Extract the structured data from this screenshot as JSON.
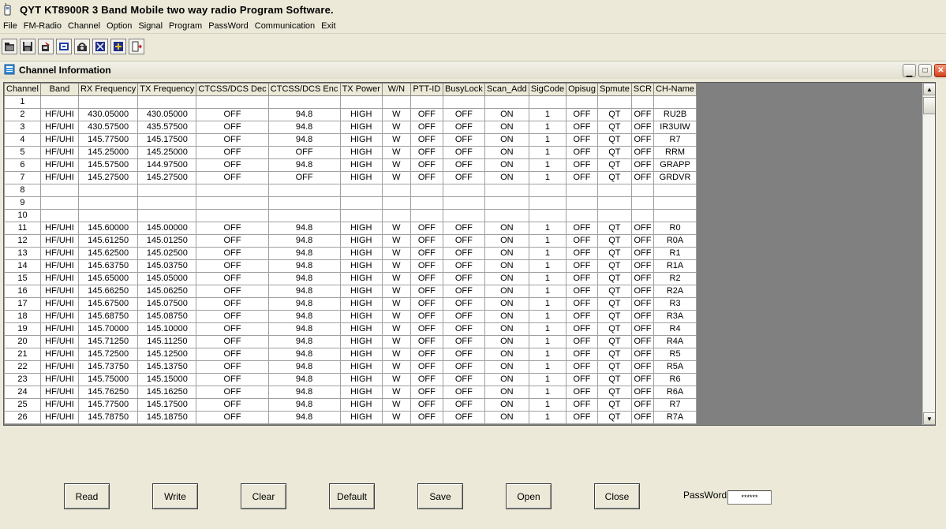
{
  "app": {
    "title": "QYT KT8900R 3 Band Mobile two way radio Program Software."
  },
  "menu": [
    "File",
    "FM-Radio",
    "Channel",
    "Option",
    "Signal",
    "Program",
    "PassWord",
    "Communication",
    "Exit"
  ],
  "toolbar": {
    "icons": [
      "open-icon",
      "save-icon",
      "read-radio-icon",
      "write-radio-icon",
      "radio-settings-icon",
      "info-icon",
      "program-icon",
      "exit-icon"
    ]
  },
  "child_window": {
    "title": "Channel Information"
  },
  "table": {
    "columns": [
      "Channel",
      "Band",
      "RX Frequency",
      "TX Frequency",
      "CTCSS/DCS Dec",
      "CTCSS/DCS Enc",
      "TX Power",
      "W/N",
      "PTT-ID",
      "BusyLock",
      "Scan_Add",
      "SigCode",
      "Opisug",
      "Spmute",
      "SCR",
      "CH-Name"
    ],
    "rows": [
      [
        "1",
        "",
        "",
        "",
        "",
        "",
        "",
        "",
        "",
        "",
        "",
        "",
        "",
        "",
        "",
        ""
      ],
      [
        "2",
        "HF/UHI",
        "430.05000",
        "430.05000",
        "OFF",
        "94.8",
        "HIGH",
        "W",
        "OFF",
        "OFF",
        "ON",
        "1",
        "OFF",
        "QT",
        "OFF",
        "RU2B"
      ],
      [
        "3",
        "HF/UHI",
        "430.57500",
        "435.57500",
        "OFF",
        "94.8",
        "HIGH",
        "W",
        "OFF",
        "OFF",
        "ON",
        "1",
        "OFF",
        "QT",
        "OFF",
        "IR3UIW"
      ],
      [
        "4",
        "HF/UHI",
        "145.77500",
        "145.17500",
        "OFF",
        "94.8",
        "HIGH",
        "W",
        "OFF",
        "OFF",
        "ON",
        "1",
        "OFF",
        "QT",
        "OFF",
        "R7"
      ],
      [
        "5",
        "HF/UHI",
        "145.25000",
        "145.25000",
        "OFF",
        "OFF",
        "HIGH",
        "W",
        "OFF",
        "OFF",
        "ON",
        "1",
        "OFF",
        "QT",
        "OFF",
        "RRM"
      ],
      [
        "6",
        "HF/UHI",
        "145.57500",
        "144.97500",
        "OFF",
        "94.8",
        "HIGH",
        "W",
        "OFF",
        "OFF",
        "ON",
        "1",
        "OFF",
        "QT",
        "OFF",
        "GRAPP"
      ],
      [
        "7",
        "HF/UHI",
        "145.27500",
        "145.27500",
        "OFF",
        "OFF",
        "HIGH",
        "W",
        "OFF",
        "OFF",
        "ON",
        "1",
        "OFF",
        "QT",
        "OFF",
        "GRDVR"
      ],
      [
        "8",
        "",
        "",
        "",
        "",
        "",
        "",
        "",
        "",
        "",
        "",
        "",
        "",
        "",
        "",
        ""
      ],
      [
        "9",
        "",
        "",
        "",
        "",
        "",
        "",
        "",
        "",
        "",
        "",
        "",
        "",
        "",
        "",
        ""
      ],
      [
        "10",
        "",
        "",
        "",
        "",
        "",
        "",
        "",
        "",
        "",
        "",
        "",
        "",
        "",
        "",
        ""
      ],
      [
        "11",
        "HF/UHI",
        "145.60000",
        "145.00000",
        "OFF",
        "94.8",
        "HIGH",
        "W",
        "OFF",
        "OFF",
        "ON",
        "1",
        "OFF",
        "QT",
        "OFF",
        "R0"
      ],
      [
        "12",
        "HF/UHI",
        "145.61250",
        "145.01250",
        "OFF",
        "94.8",
        "HIGH",
        "W",
        "OFF",
        "OFF",
        "ON",
        "1",
        "OFF",
        "QT",
        "OFF",
        "R0A"
      ],
      [
        "13",
        "HF/UHI",
        "145.62500",
        "145.02500",
        "OFF",
        "94.8",
        "HIGH",
        "W",
        "OFF",
        "OFF",
        "ON",
        "1",
        "OFF",
        "QT",
        "OFF",
        "R1"
      ],
      [
        "14",
        "HF/UHI",
        "145.63750",
        "145.03750",
        "OFF",
        "94.8",
        "HIGH",
        "W",
        "OFF",
        "OFF",
        "ON",
        "1",
        "OFF",
        "QT",
        "OFF",
        "R1A"
      ],
      [
        "15",
        "HF/UHI",
        "145.65000",
        "145.05000",
        "OFF",
        "94.8",
        "HIGH",
        "W",
        "OFF",
        "OFF",
        "ON",
        "1",
        "OFF",
        "QT",
        "OFF",
        "R2"
      ],
      [
        "16",
        "HF/UHI",
        "145.66250",
        "145.06250",
        "OFF",
        "94.8",
        "HIGH",
        "W",
        "OFF",
        "OFF",
        "ON",
        "1",
        "OFF",
        "QT",
        "OFF",
        "R2A"
      ],
      [
        "17",
        "HF/UHI",
        "145.67500",
        "145.07500",
        "OFF",
        "94.8",
        "HIGH",
        "W",
        "OFF",
        "OFF",
        "ON",
        "1",
        "OFF",
        "QT",
        "OFF",
        "R3"
      ],
      [
        "18",
        "HF/UHI",
        "145.68750",
        "145.08750",
        "OFF",
        "94.8",
        "HIGH",
        "W",
        "OFF",
        "OFF",
        "ON",
        "1",
        "OFF",
        "QT",
        "OFF",
        "R3A"
      ],
      [
        "19",
        "HF/UHI",
        "145.70000",
        "145.10000",
        "OFF",
        "94.8",
        "HIGH",
        "W",
        "OFF",
        "OFF",
        "ON",
        "1",
        "OFF",
        "QT",
        "OFF",
        "R4"
      ],
      [
        "20",
        "HF/UHI",
        "145.71250",
        "145.11250",
        "OFF",
        "94.8",
        "HIGH",
        "W",
        "OFF",
        "OFF",
        "ON",
        "1",
        "OFF",
        "QT",
        "OFF",
        "R4A"
      ],
      [
        "21",
        "HF/UHI",
        "145.72500",
        "145.12500",
        "OFF",
        "94.8",
        "HIGH",
        "W",
        "OFF",
        "OFF",
        "ON",
        "1",
        "OFF",
        "QT",
        "OFF",
        "R5"
      ],
      [
        "22",
        "HF/UHI",
        "145.73750",
        "145.13750",
        "OFF",
        "94.8",
        "HIGH",
        "W",
        "OFF",
        "OFF",
        "ON",
        "1",
        "OFF",
        "QT",
        "OFF",
        "R5A"
      ],
      [
        "23",
        "HF/UHI",
        "145.75000",
        "145.15000",
        "OFF",
        "94.8",
        "HIGH",
        "W",
        "OFF",
        "OFF",
        "ON",
        "1",
        "OFF",
        "QT",
        "OFF",
        "R6"
      ],
      [
        "24",
        "HF/UHI",
        "145.76250",
        "145.16250",
        "OFF",
        "94.8",
        "HIGH",
        "W",
        "OFF",
        "OFF",
        "ON",
        "1",
        "OFF",
        "QT",
        "OFF",
        "R6A"
      ],
      [
        "25",
        "HF/UHI",
        "145.77500",
        "145.17500",
        "OFF",
        "94.8",
        "HIGH",
        "W",
        "OFF",
        "OFF",
        "ON",
        "1",
        "OFF",
        "QT",
        "OFF",
        "R7"
      ],
      [
        "26",
        "HF/UHI",
        "145.78750",
        "145.18750",
        "OFF",
        "94.8",
        "HIGH",
        "W",
        "OFF",
        "OFF",
        "ON",
        "1",
        "OFF",
        "QT",
        "OFF",
        "R7A"
      ]
    ]
  },
  "buttons": {
    "read": "Read",
    "write": "Write",
    "clear": "Clear",
    "default": "Default",
    "save": "Save",
    "open": "Open",
    "close": "Close"
  },
  "password": {
    "label": "PassWord",
    "value": "******"
  },
  "colors": {
    "face": "#ece9d8",
    "grid_bg": "#808080",
    "close_button": "#d2401b"
  }
}
